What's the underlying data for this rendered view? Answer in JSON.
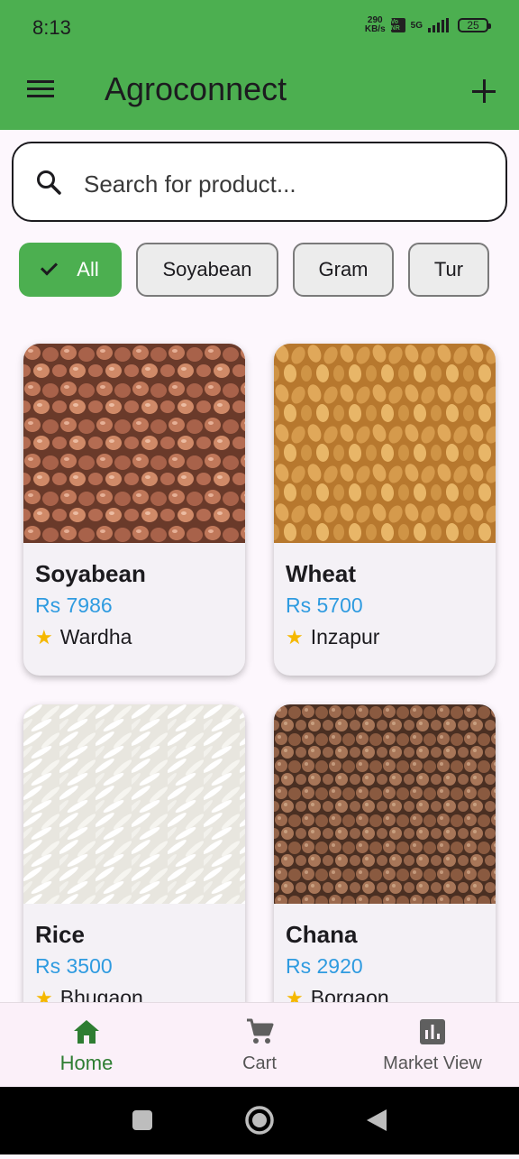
{
  "status_bar": {
    "time": "8:13",
    "net_speed_value": "290",
    "net_speed_unit": "KB/s",
    "volte": "Vo NR",
    "network_type": "5G",
    "battery": "25"
  },
  "app_bar": {
    "title": "Agroconnect",
    "menu_icon": "hamburger-menu-icon",
    "add_icon": "plus-icon",
    "color": "#4caf50"
  },
  "search": {
    "placeholder": "Search for product...",
    "value": ""
  },
  "filters": [
    {
      "label": "All",
      "selected": true
    },
    {
      "label": "Soyabean",
      "selected": false
    },
    {
      "label": "Gram",
      "selected": false
    },
    {
      "label": "Tur",
      "selected": false
    }
  ],
  "products": [
    {
      "name": "Soyabean",
      "price": "Rs 7986",
      "location": "Wardha",
      "image": "soyabean-image"
    },
    {
      "name": "Wheat",
      "price": "Rs 5700",
      "location": "Inzapur",
      "image": "wheat-image"
    },
    {
      "name": "Rice",
      "price": "Rs 3500",
      "location": "Bhugaon",
      "image": "rice-image"
    },
    {
      "name": "Chana",
      "price": "Rs 2920",
      "location": "Borgaon",
      "image": "chana-image"
    }
  ],
  "bottom_nav": [
    {
      "label": "Home",
      "icon": "home-icon",
      "active": true
    },
    {
      "label": "Cart",
      "icon": "cart-icon",
      "active": false
    },
    {
      "label": "Market View",
      "icon": "bar-chart-icon",
      "active": false
    }
  ],
  "system_nav": [
    "recents-button",
    "home-button",
    "back-button"
  ],
  "colors": {
    "primary": "#4caf50",
    "price": "#2f9be0",
    "star": "#f5b800",
    "active_nav": "#2e7d32"
  }
}
